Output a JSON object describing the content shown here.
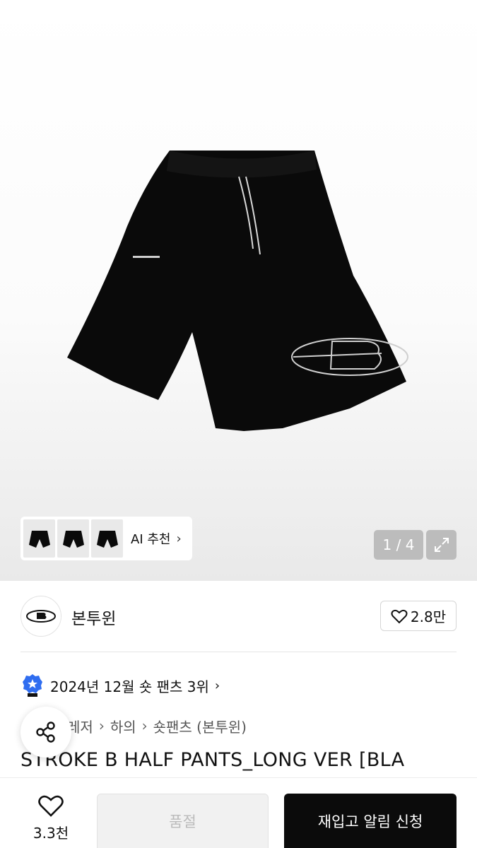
{
  "gallery": {
    "current": "1",
    "total": "4",
    "counter_text": "1 / 4",
    "image_subject": "black shorts",
    "ai_recommend_label": "AI 추천"
  },
  "brand": {
    "name": "본투윈",
    "likes": "2.8만"
  },
  "ranking": {
    "text": "2024년 12월 숏 팬츠 3위"
  },
  "breadcrumb": [
    "레저",
    "하의",
    "숏팬츠 (본투윈)"
  ],
  "product": {
    "title": "STROKE B HALF PANTS_LONG VER [BLA"
  },
  "bottom_bar": {
    "wish_count": "3.3천",
    "soldout_label": "품절",
    "restock_label": "재입고 알림 신청"
  },
  "colors": {
    "primary_button": "#0b0b0b",
    "rank_badge": "#2f6df0"
  },
  "icons": [
    "chevron-right-icon",
    "expand-icon",
    "heart-icon",
    "rank-badge-icon",
    "share-icon"
  ]
}
